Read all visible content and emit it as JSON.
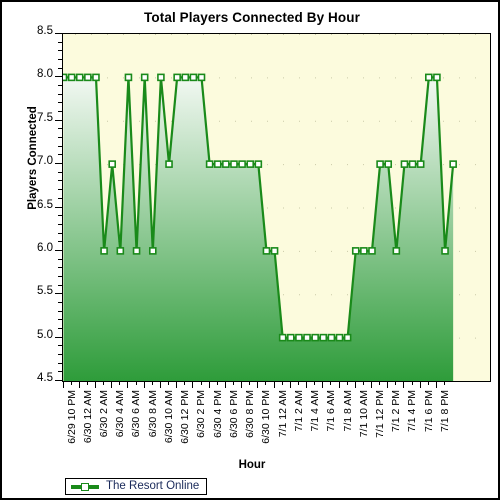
{
  "chart_data": {
    "type": "line",
    "title": "Total Players Connected By Hour",
    "xlabel": "Hour",
    "ylabel": "Players Connected",
    "ylim": [
      4.5,
      8.5
    ],
    "ytick_step": 0.5,
    "yticks": [
      "4.5",
      "5.0",
      "5.5",
      "6.0",
      "6.5",
      "7.0",
      "7.5",
      "8.0",
      "8.5"
    ],
    "grid": true,
    "legend_position": "bottom-left",
    "series": [
      {
        "name": "The Resort Online",
        "color": "#1a8a1a",
        "marker": "square-open",
        "values": [
          8,
          8,
          8,
          8,
          8,
          6,
          7,
          6,
          8,
          6,
          8,
          6,
          8,
          7,
          8,
          8,
          8,
          8,
          7,
          7,
          7,
          7,
          7,
          7,
          7,
          6,
          6,
          5,
          5,
          5,
          5,
          5,
          5,
          5,
          5,
          5,
          6,
          6,
          6,
          7,
          7,
          6,
          7,
          7,
          7,
          8,
          8,
          6,
          7
        ]
      }
    ],
    "x": [
      "6/29 10 PM",
      "6/29 11 PM",
      "6/30 12 AM",
      "6/30 1 AM",
      "6/30 2 AM",
      "6/30 3 AM",
      "6/30 4 AM",
      "6/30 5 AM",
      "6/30 6 AM",
      "6/30 7 AM",
      "6/30 8 AM",
      "6/30 9 AM",
      "6/30 10 AM",
      "6/30 11 AM",
      "6/30 12 PM",
      "6/30 1 PM",
      "6/30 2 PM",
      "6/30 3 PM",
      "6/30 4 PM",
      "6/30 5 PM",
      "6/30 6 PM",
      "6/30 7 PM",
      "6/30 8 PM",
      "6/30 9 PM",
      "6/30 10 PM",
      "6/30 11 PM",
      "7/1 12 AM",
      "7/1 1 AM",
      "7/1 2 AM",
      "7/1 3 AM",
      "7/1 4 AM",
      "7/1 5 AM",
      "7/1 6 AM",
      "7/1 7 AM",
      "7/1 8 AM",
      "7/1 9 AM",
      "7/1 10 AM",
      "7/1 11 AM",
      "7/1 12 PM",
      "7/1 1 PM",
      "7/1 2 PM",
      "7/1 3 PM",
      "7/1 4 PM",
      "7/1 5 PM",
      "7/1 6 PM",
      "7/1 7 PM",
      "7/1 8 PM",
      "7/1 9 PM",
      "7/1 10 PM"
    ],
    "xtick_labels": [
      "6/29 10 PM",
      "6/30 12 AM",
      "6/30 2 AM",
      "6/30 4 AM",
      "6/30 6 AM",
      "6/30 8 AM",
      "6/30 10 AM",
      "6/30 12 PM",
      "6/30 2 PM",
      "6/30 4 PM",
      "6/30 6 PM",
      "6/30 8 PM",
      "6/30 10 PM",
      "7/1 12 AM",
      "7/1 2 AM",
      "7/1 4 AM",
      "7/1 6 AM",
      "7/1 8 AM",
      "7/1 10 AM",
      "7/1 12 PM",
      "7/1 2 PM",
      "7/1 4 PM",
      "7/1 6 PM",
      "7/1 8 PM"
    ]
  },
  "legend": {
    "entries": [
      {
        "label": "The Resort Online",
        "color": "#1a8a1a"
      }
    ]
  },
  "colors": {
    "plot_background": "#fcfbdd",
    "line": "#1a8a1a",
    "fill_top": "#f2f8f2",
    "fill_bottom": "#2e9c3a",
    "axis": "#000000",
    "legend_text": "#1a2a5a"
  }
}
